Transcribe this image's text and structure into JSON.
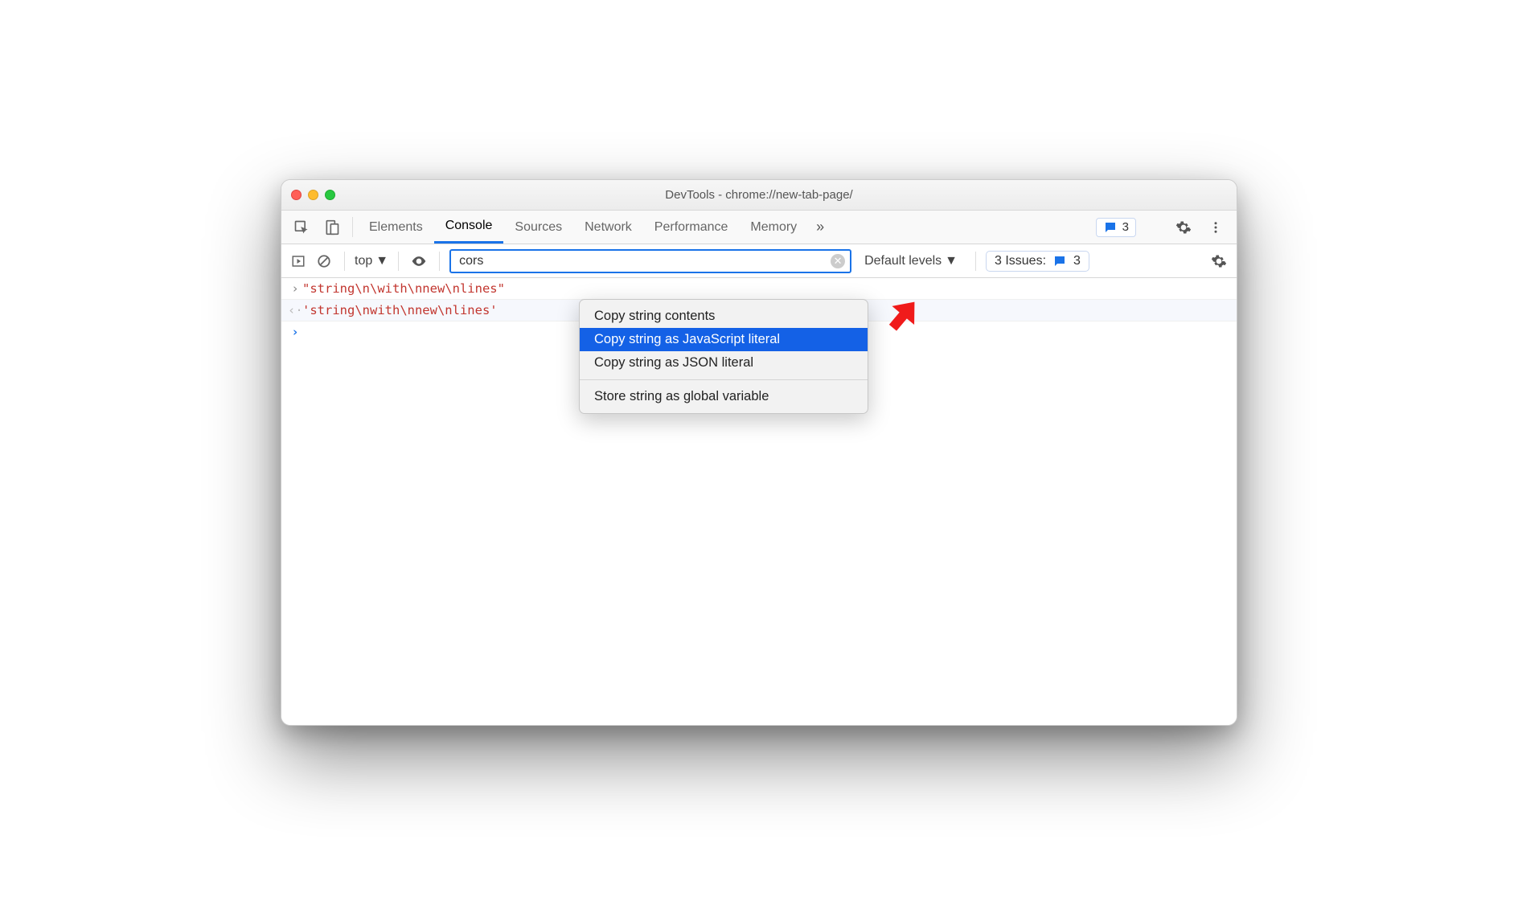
{
  "window": {
    "title": "DevTools - chrome://new-tab-page/"
  },
  "tabs": {
    "items": [
      "Elements",
      "Console",
      "Sources",
      "Network",
      "Performance",
      "Memory"
    ],
    "active_index": 1,
    "issues_badge_count": "3"
  },
  "toolbar": {
    "context": "top",
    "filter_value": "cors",
    "levels": "Default levels",
    "issues_label": "3 Issues:",
    "issues_count": "3"
  },
  "console": {
    "input_line": "\"string\\n\\with\\nnew\\nlines\"",
    "output_line": "'string\\nwith\\nnew\\nlines'"
  },
  "context_menu": {
    "items": [
      "Copy string contents",
      "Copy string as JavaScript literal",
      "Copy string as JSON literal"
    ],
    "extra_items": [
      "Store string as global variable"
    ],
    "selected_index": 1
  }
}
